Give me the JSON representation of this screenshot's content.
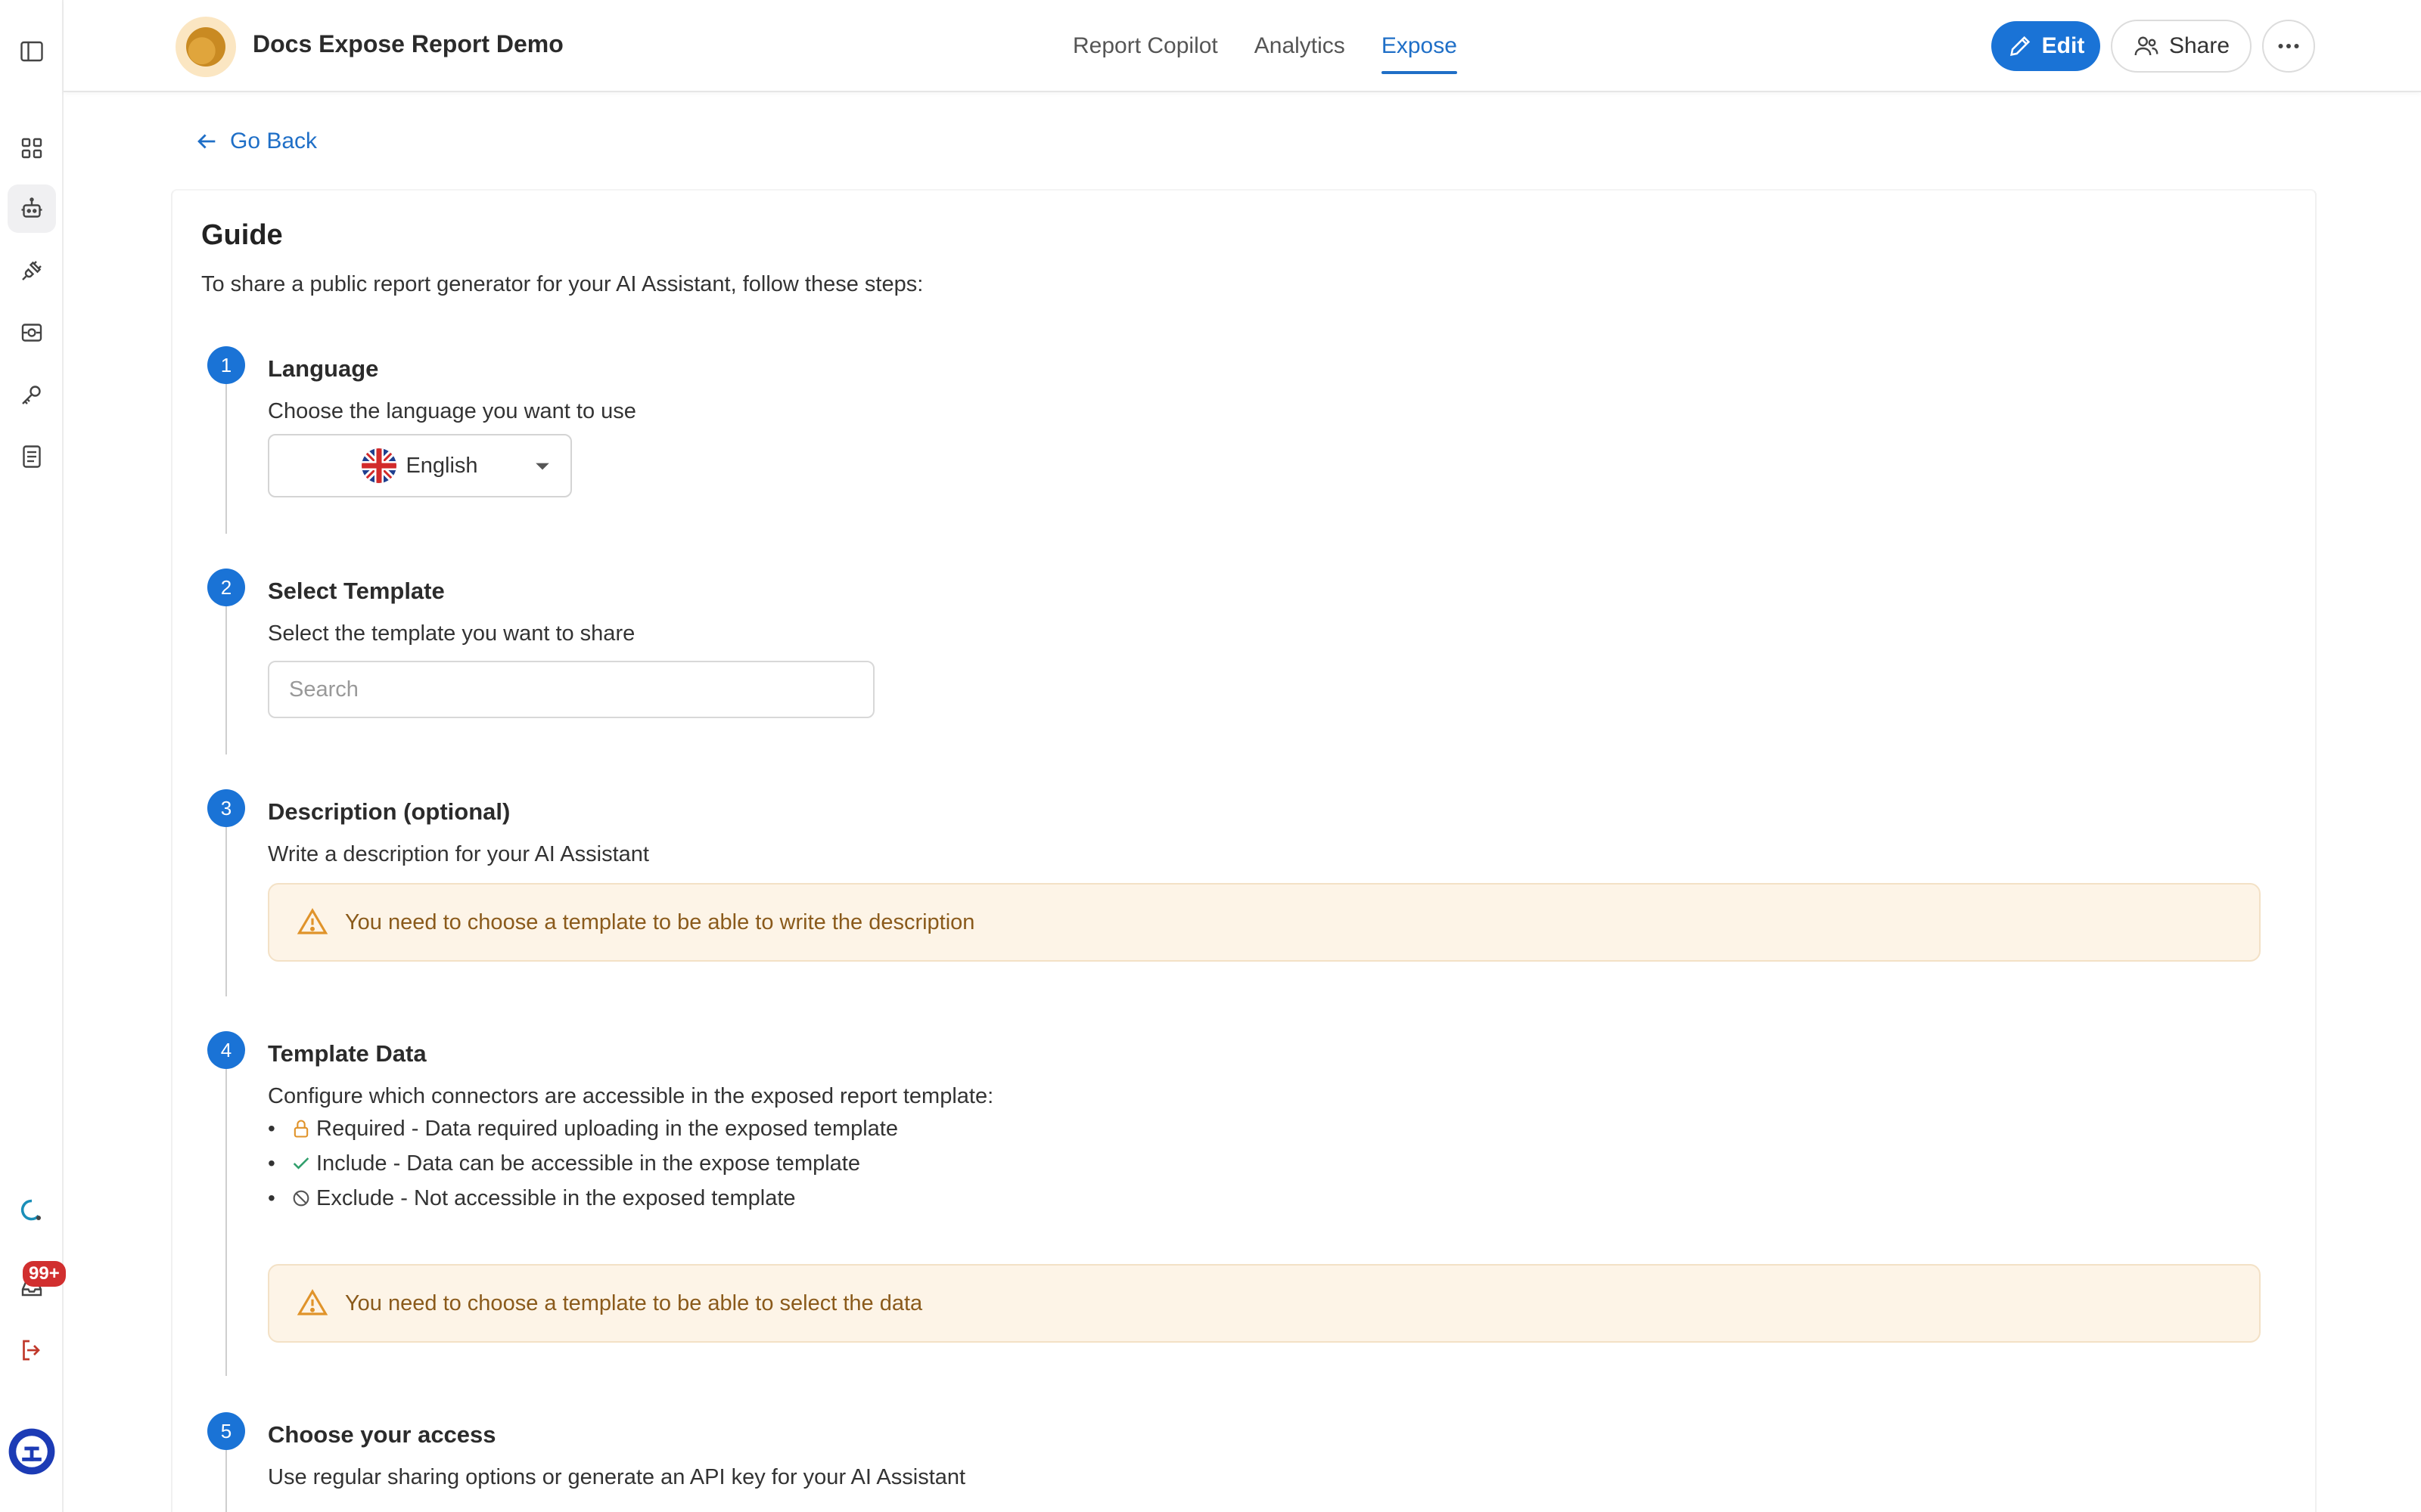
{
  "header": {
    "app_title": "Docs Expose Report Demo",
    "tabs": [
      {
        "label": "Report Copilot"
      },
      {
        "label": "Analytics"
      },
      {
        "label": "Expose"
      }
    ],
    "edit_label": "Edit",
    "share_label": "Share"
  },
  "sidebar": {
    "items": [
      {
        "icon": "sidebar-toggle-icon"
      },
      {
        "icon": "dashboard-grid-icon"
      },
      {
        "icon": "bot-icon"
      },
      {
        "icon": "plug-icon"
      },
      {
        "icon": "screen-capture-icon"
      },
      {
        "icon": "key-icon"
      },
      {
        "icon": "document-icon"
      }
    ],
    "notification_badge": "99+"
  },
  "content": {
    "back_label": "Go Back",
    "guide_title": "Guide",
    "guide_subtitle": "To share a public report generator for your AI Assistant, follow these steps:",
    "steps": [
      {
        "number": "1",
        "title": "Language",
        "description": "Choose the language you want to use"
      },
      {
        "number": "2",
        "title": "Select Template",
        "description": "Select the template you want to share"
      },
      {
        "number": "3",
        "title": "Description (optional)",
        "description": "Write a description for your AI Assistant"
      },
      {
        "number": "4",
        "title": "Template Data",
        "description": "Configure which connectors are accessible in the exposed report template:"
      },
      {
        "number": "5",
        "title": "Choose your access",
        "description": "Use regular sharing options or generate an API key for your AI Assistant"
      }
    ],
    "language_value": "English",
    "search_placeholder": "Search",
    "warning_description": "You need to choose a template to be able to write the description",
    "warning_data": "You need to choose a template to be able to select the data",
    "bullets": [
      {
        "bullet": "•",
        "icon": "lock-icon",
        "text": "Required - Data required uploading in the exposed template"
      },
      {
        "bullet": "•",
        "icon": "check-icon",
        "text": "Include - Data can be accessible in the expose template"
      },
      {
        "bullet": "•",
        "icon": "block-icon",
        "text": "Exclude - Not accessible in the exposed template"
      }
    ]
  },
  "colors": {
    "accent": "#1a73d6",
    "warning_bg": "#fdf4e7",
    "warning_text": "#8a5a1b",
    "badge": "#d12f2f"
  }
}
